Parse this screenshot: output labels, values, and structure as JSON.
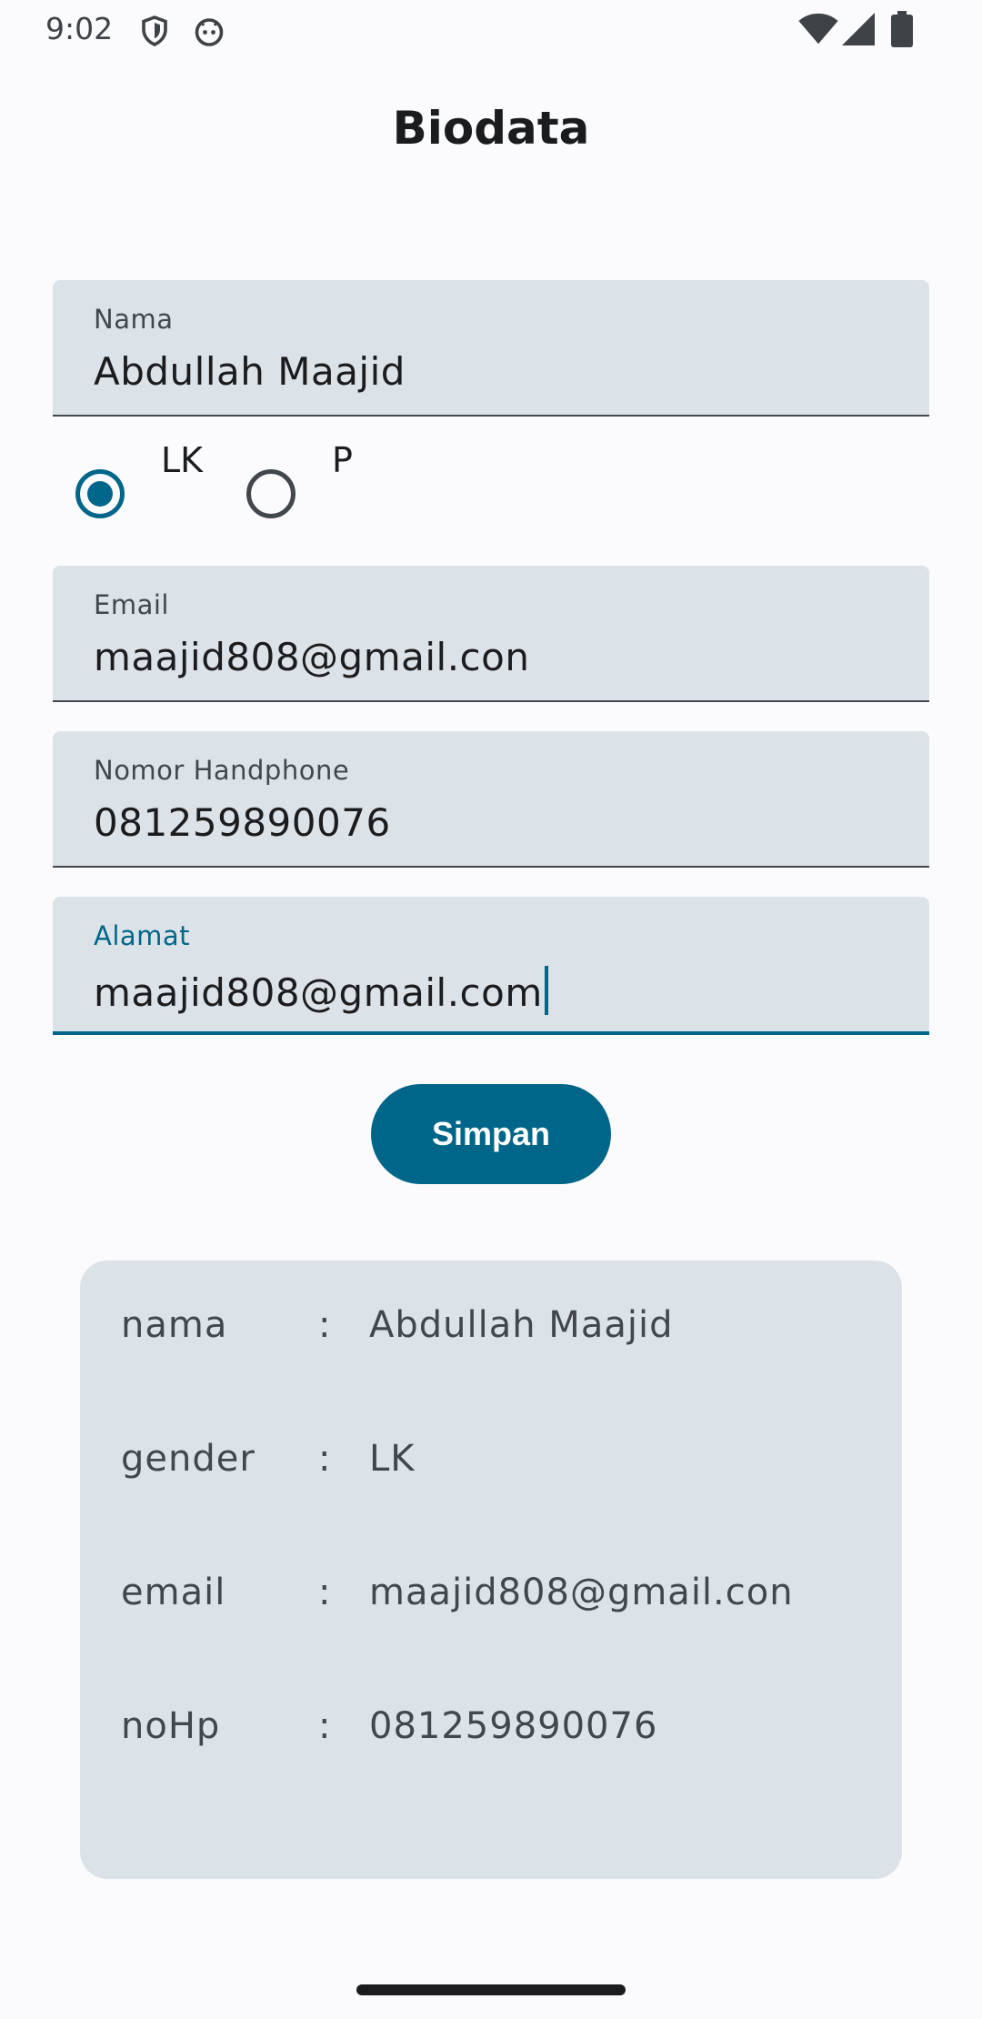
{
  "status_bar": {
    "time": "9:02",
    "icons": [
      "shield-icon",
      "android-robot-icon",
      "wifi-icon",
      "signal-icon",
      "battery-icon"
    ]
  },
  "title": "Biodata",
  "form": {
    "nama": {
      "label": "Nama",
      "value": "Abdullah Maajid"
    },
    "gender": {
      "options": [
        {
          "label": "LK",
          "selected": true
        },
        {
          "label": "P",
          "selected": false
        }
      ]
    },
    "email": {
      "label": "Email",
      "value": "maajid808@gmail.con"
    },
    "nomor": {
      "label": "Nomor Handphone",
      "value": "081259890076"
    },
    "alamat": {
      "label": "Alamat",
      "value": "maajid808@gmail.com"
    },
    "save_label": "Simpan"
  },
  "result": {
    "rows": [
      {
        "key": "nama",
        "sep": ":",
        "value": "Abdullah Maajid"
      },
      {
        "key": "gender",
        "sep": ":",
        "value": "LK"
      },
      {
        "key": "email",
        "sep": ":",
        "value": "maajid808@gmail.con"
      },
      {
        "key": "noHp",
        "sep": ":",
        "value": "081259890076"
      }
    ]
  },
  "colors": {
    "primary": "#006689",
    "field_bg": "#dce3e8",
    "background": "#fbfbfd"
  }
}
